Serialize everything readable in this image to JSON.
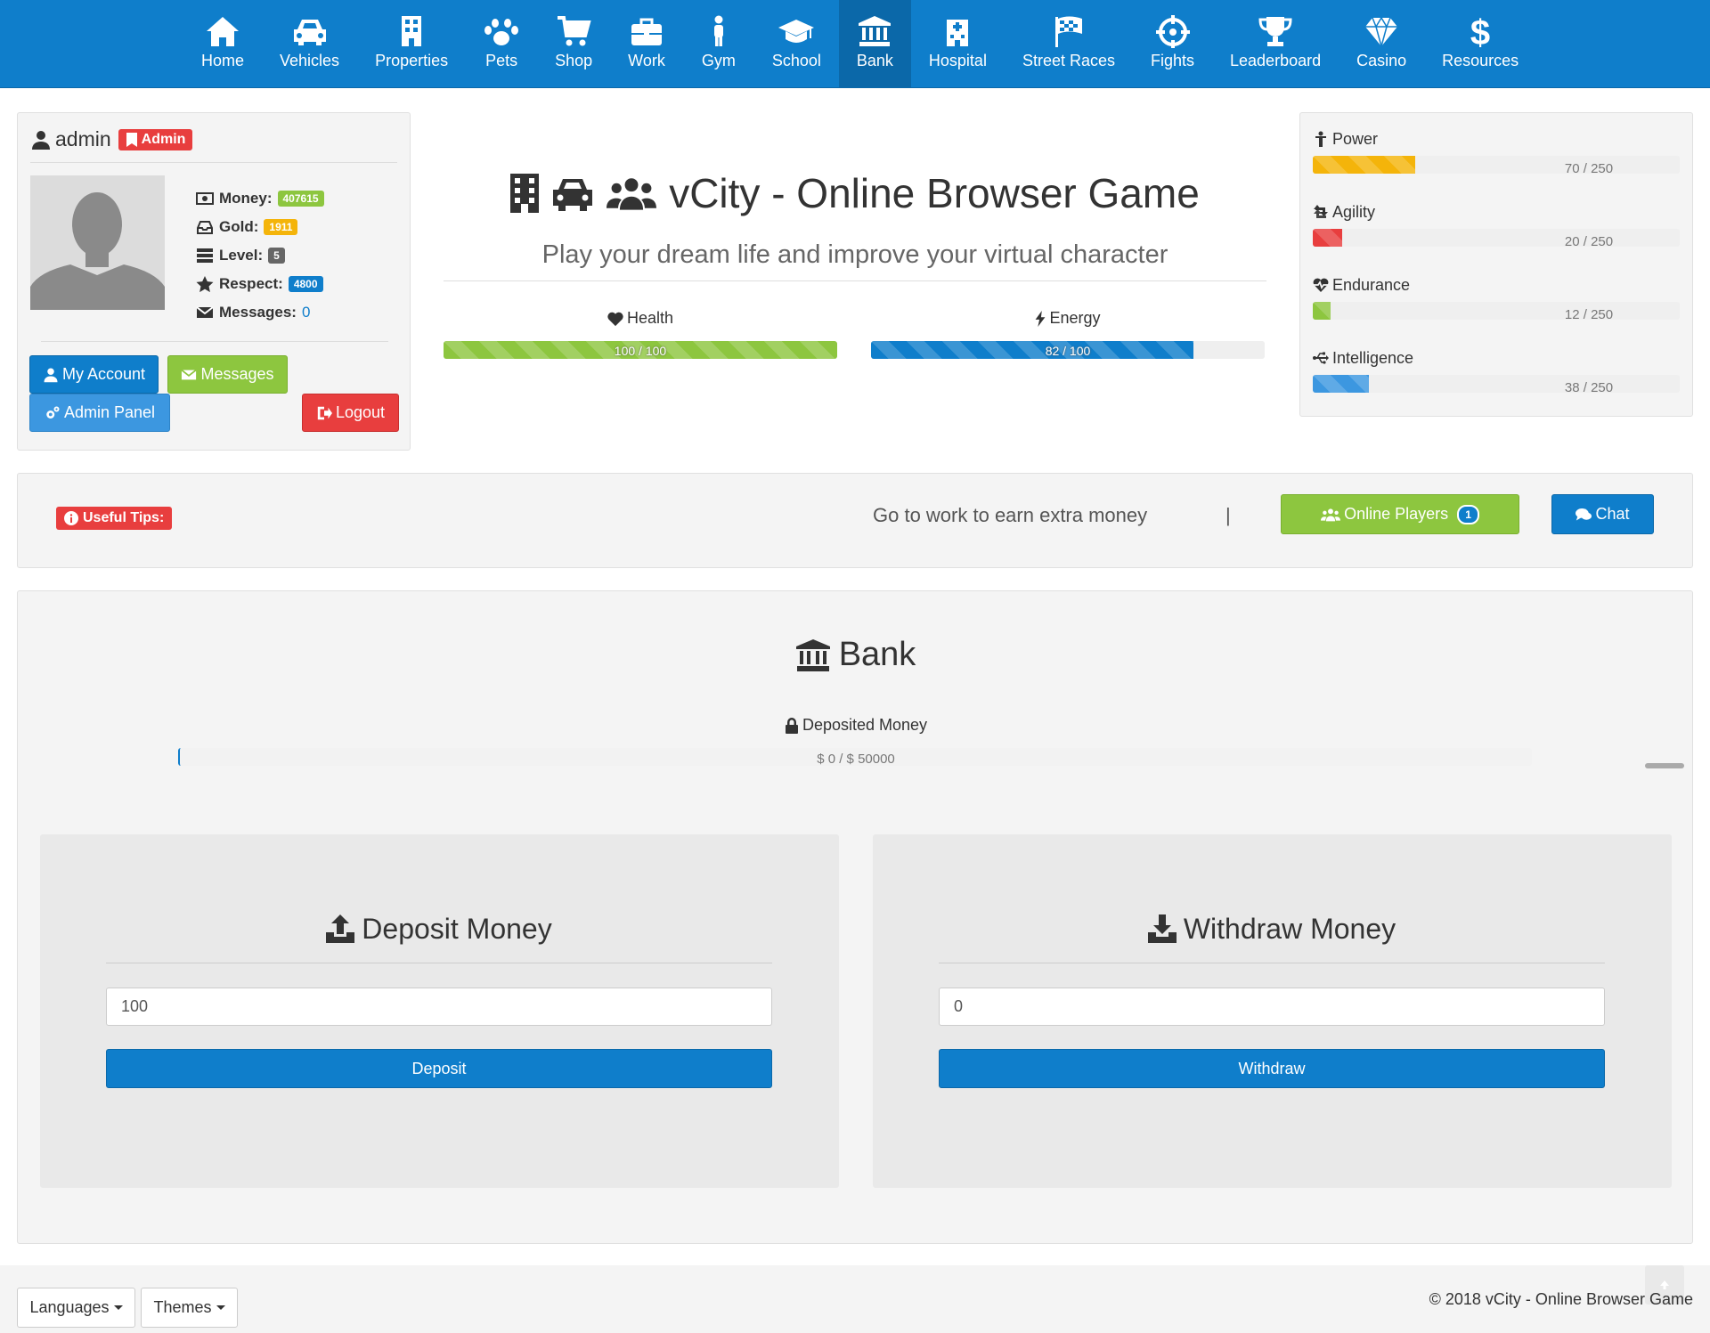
{
  "nav": {
    "items": [
      {
        "label": "Home",
        "icon": "home-icon"
      },
      {
        "label": "Vehicles",
        "icon": "car-icon"
      },
      {
        "label": "Properties",
        "icon": "building-icon"
      },
      {
        "label": "Pets",
        "icon": "paw-icon"
      },
      {
        "label": "Shop",
        "icon": "cart-icon"
      },
      {
        "label": "Work",
        "icon": "briefcase-icon"
      },
      {
        "label": "Gym",
        "icon": "person-icon"
      },
      {
        "label": "School",
        "icon": "graduation-cap-icon"
      },
      {
        "label": "Bank",
        "icon": "bank-icon",
        "active": true
      },
      {
        "label": "Hospital",
        "icon": "hospital-icon"
      },
      {
        "label": "Street Races",
        "icon": "flag-checkered-icon"
      },
      {
        "label": "Fights",
        "icon": "crosshairs-icon"
      },
      {
        "label": "Leaderboard",
        "icon": "trophy-icon"
      },
      {
        "label": "Casino",
        "icon": "diamond-icon"
      },
      {
        "label": "Resources",
        "icon": "dollar-icon"
      }
    ]
  },
  "profile": {
    "username": "admin",
    "role_badge": "Admin",
    "money_label": "Money:",
    "money": "407615",
    "gold_label": "Gold:",
    "gold": "1911",
    "level_label": "Level:",
    "level": "5",
    "respect_label": "Respect:",
    "respect": "4800",
    "messages_label": "Messages:",
    "messages": "0",
    "buttons": {
      "my_account": "My Account",
      "messages": "Messages",
      "admin_panel": "Admin Panel",
      "logout": "Logout"
    }
  },
  "hero": {
    "title": "vCity - Online Browser Game",
    "subtitle": "Play your dream life and improve your virtual character"
  },
  "vitals": {
    "health": {
      "label": "Health",
      "text": "100 / 100",
      "value": 100,
      "max": 100,
      "color": "#8dc63f"
    },
    "energy": {
      "label": "Energy",
      "text": "82 / 100",
      "value": 82,
      "max": 100,
      "color": "#0f7ecb"
    }
  },
  "stats": [
    {
      "label": "Power",
      "text": "70 / 250",
      "value": 70,
      "max": 250,
      "color": "#f4b40a",
      "icon": "power-icon"
    },
    {
      "label": "Agility",
      "text": "20 / 250",
      "value": 20,
      "max": 250,
      "color": "#e83e3e",
      "icon": "retweet-icon"
    },
    {
      "label": "Endurance",
      "text": "12 / 250",
      "value": 12,
      "max": 250,
      "color": "#8dc63f",
      "icon": "heartbeat-icon"
    },
    {
      "label": "Intelligence",
      "text": "38 / 250",
      "value": 38,
      "max": 250,
      "color": "#3c97e0",
      "icon": "usb-icon"
    }
  ],
  "tips": {
    "badge": "Useful Tips:",
    "text": "Go to work to earn extra money",
    "separator": "|",
    "online_label": "Online Players",
    "online_count": "1",
    "chat_label": "Chat"
  },
  "bank": {
    "title": "Bank",
    "deposited_label": "Deposited Money",
    "deposited_text": "$ 0 / $ 50000",
    "deposited_value": 0,
    "deposited_max": 50000,
    "deposit": {
      "title": "Deposit Money",
      "value": "100",
      "button": "Deposit"
    },
    "withdraw": {
      "title": "Withdraw Money",
      "value": "0",
      "button": "Withdraw"
    }
  },
  "footer": {
    "languages": "Languages",
    "themes": "Themes",
    "copyright": "© 2018 vCity - Online Browser Game"
  }
}
